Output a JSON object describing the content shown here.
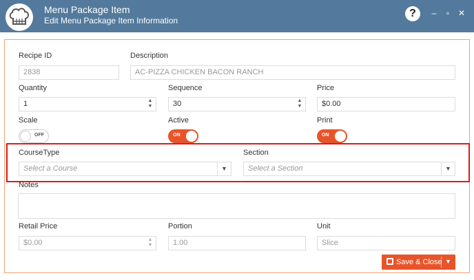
{
  "window": {
    "title": "Menu Package Item",
    "subtitle": "Edit Menu Package Item Information",
    "help_label": "?",
    "minimize_glyph": "–",
    "maximize_glyph": "▫",
    "close_glyph": "✕"
  },
  "form": {
    "recipe_id": {
      "label": "Recipe ID",
      "value": "2838"
    },
    "description": {
      "label": "Description",
      "value": "AC-PIZZA CHICKEN BACON RANCH"
    },
    "quantity": {
      "label": "Quantity",
      "value": "1"
    },
    "sequence": {
      "label": "Sequence",
      "value": "30"
    },
    "price": {
      "label": "Price",
      "value": "$0.00"
    },
    "scale": {
      "label": "Scale",
      "state": "OFF"
    },
    "active": {
      "label": "Active",
      "state": "ON"
    },
    "print": {
      "label": "Print",
      "state": "ON"
    },
    "course_type": {
      "label": "CourseType",
      "placeholder": "Select a Course"
    },
    "section": {
      "label": "Section",
      "placeholder": "Select a Section"
    },
    "notes": {
      "label": "Notes",
      "value": ""
    },
    "retail_price": {
      "label": "Retail Price",
      "value": "$0.00"
    },
    "portion": {
      "label": "Portion",
      "value": "1.00"
    },
    "unit": {
      "label": "Unit",
      "value": "Slice"
    }
  },
  "actions": {
    "save_close_label": "Save & Close"
  },
  "colors": {
    "titlebar": "#537a9c",
    "accent": "#e8542a",
    "highlight": "#e01818"
  },
  "icons": [
    "chef-hat-icon",
    "help-icon",
    "minimize-icon",
    "maximize-icon",
    "close-icon",
    "save-icon",
    "chevron-down-icon"
  ]
}
